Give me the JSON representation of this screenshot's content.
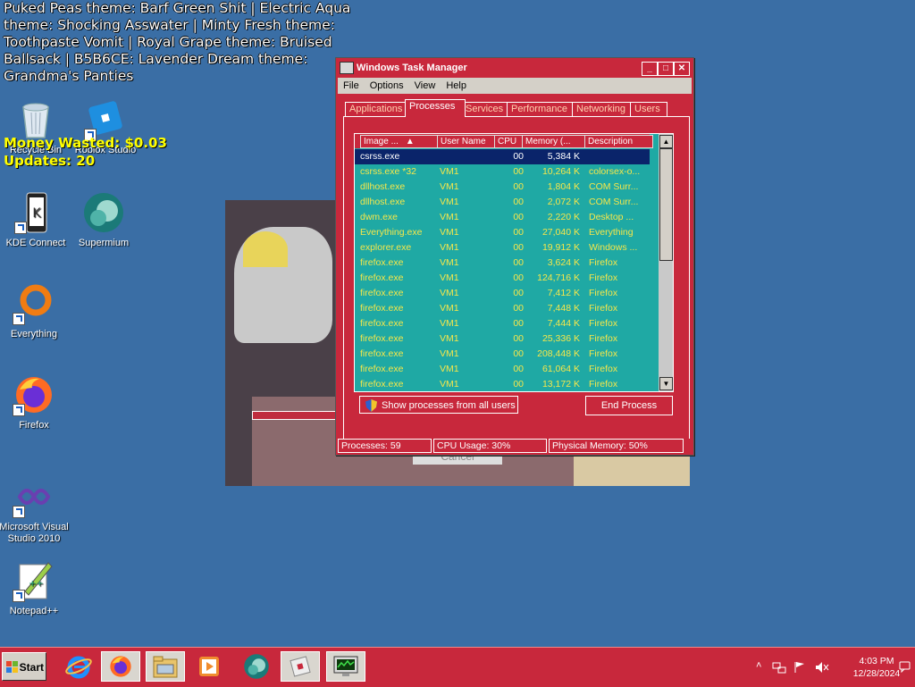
{
  "overlay": {
    "theme_text": "Puked Peas theme: Barf Green Shit | Electric Aqua theme: Shocking Asswater | Minty Fresh theme: Toothpaste Vomit | Royal Grape theme: Bruised Ballsack | B5B6CE: Lavender Dream theme: Grandma's Panties",
    "money_wasted": "Money Wasted: $0.03",
    "updates": "Updates: 20"
  },
  "desktop_icons": [
    {
      "label": "Recycle Bin",
      "icon": "recycle-bin-icon"
    },
    {
      "label": "Roblox Studio",
      "icon": "roblox-studio-icon"
    },
    {
      "label": "KDE Connect",
      "icon": "kde-connect-icon"
    },
    {
      "label": "Supermium",
      "icon": "supermium-icon"
    },
    {
      "label": "Everything",
      "icon": "everything-icon"
    },
    {
      "label": "Firefox",
      "icon": "firefox-icon"
    },
    {
      "label": "Microsoft Visual Studio 2010",
      "icon": "visual-studio-icon"
    },
    {
      "label": "Notepad++",
      "icon": "notepad-plus-plus-icon"
    }
  ],
  "background_window": {
    "cancel_label": "Cancel"
  },
  "task_manager": {
    "title": "Windows Task Manager",
    "window_buttons": {
      "minimize": "_",
      "maximize": "□",
      "close": "✕"
    },
    "menu": [
      "File",
      "Options",
      "View",
      "Help"
    ],
    "tabs": [
      "Applications",
      "Processes",
      "Services",
      "Performance",
      "Networking",
      "Users"
    ],
    "active_tab": "Processes",
    "columns": [
      "Image ...",
      "User Name",
      "CPU",
      "Memory (...",
      "Description"
    ],
    "rows": [
      {
        "image": "csrss.exe",
        "user": "",
        "cpu": "00",
        "memory": "5,384 K",
        "description": "",
        "selected": true
      },
      {
        "image": "csrss.exe *32",
        "user": "VM1",
        "cpu": "00",
        "memory": "10,264 K",
        "description": "colorsex-o..."
      },
      {
        "image": "dllhost.exe",
        "user": "VM1",
        "cpu": "00",
        "memory": "1,804 K",
        "description": "COM Surr..."
      },
      {
        "image": "dllhost.exe",
        "user": "VM1",
        "cpu": "00",
        "memory": "2,072 K",
        "description": "COM Surr..."
      },
      {
        "image": "dwm.exe",
        "user": "VM1",
        "cpu": "00",
        "memory": "2,220 K",
        "description": "Desktop ..."
      },
      {
        "image": "Everything.exe",
        "user": "VM1",
        "cpu": "00",
        "memory": "27,040 K",
        "description": "Everything"
      },
      {
        "image": "explorer.exe",
        "user": "VM1",
        "cpu": "00",
        "memory": "19,912 K",
        "description": "Windows ..."
      },
      {
        "image": "firefox.exe",
        "user": "VM1",
        "cpu": "00",
        "memory": "3,624 K",
        "description": "Firefox"
      },
      {
        "image": "firefox.exe",
        "user": "VM1",
        "cpu": "00",
        "memory": "124,716 K",
        "description": "Firefox"
      },
      {
        "image": "firefox.exe",
        "user": "VM1",
        "cpu": "00",
        "memory": "7,412 K",
        "description": "Firefox"
      },
      {
        "image": "firefox.exe",
        "user": "VM1",
        "cpu": "00",
        "memory": "7,448 K",
        "description": "Firefox"
      },
      {
        "image": "firefox.exe",
        "user": "VM1",
        "cpu": "00",
        "memory": "7,444 K",
        "description": "Firefox"
      },
      {
        "image": "firefox.exe",
        "user": "VM1",
        "cpu": "00",
        "memory": "25,336 K",
        "description": "Firefox"
      },
      {
        "image": "firefox.exe",
        "user": "VM1",
        "cpu": "00",
        "memory": "208,448 K",
        "description": "Firefox"
      },
      {
        "image": "firefox.exe",
        "user": "VM1",
        "cpu": "00",
        "memory": "61,064 K",
        "description": "Firefox"
      },
      {
        "image": "firefox.exe",
        "user": "VM1",
        "cpu": "00",
        "memory": "13,172 K",
        "description": "Firefox"
      }
    ],
    "show_all_users_label": "Show processes from all users",
    "end_process_label": "End Process",
    "status": {
      "processes": "Processes: 59",
      "cpu_usage": "CPU Usage: 30%",
      "physical_memory": "Physical Memory: 50%"
    }
  },
  "taskbar": {
    "start_label": "Start",
    "pinned": [
      "internet-explorer-icon",
      "firefox-icon",
      "file-explorer-icon",
      "media-player-icon",
      "supermium-icon",
      "roblox-icon",
      "task-manager-icon"
    ],
    "clock_time": "4:03 PM",
    "clock_date": "12/28/2024"
  },
  "colors": {
    "desktop": "#3a6ea5",
    "accent_red": "#c8283c",
    "list_bg": "#1fa9a4",
    "list_text": "#f6e74a",
    "selection": "#0a246a"
  }
}
